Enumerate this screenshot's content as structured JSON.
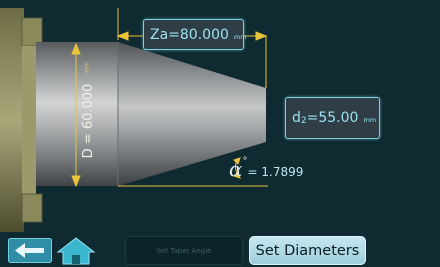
{
  "za": {
    "prefix": "Za",
    "value": "=80.000",
    "unit": "mm"
  },
  "d2": {
    "prefix": "d",
    "sub": "2",
    "value": "=55.00",
    "unit": "mm"
  },
  "diameter": {
    "label": "D = 60.000",
    "unit": "mm"
  },
  "alpha": {
    "symbol": "α",
    "degree": "°",
    "value": "= 1.7899"
  },
  "buttons": {
    "set_taper": "Set Taper Angle",
    "set_diameters": "Set Diameters"
  },
  "icons": {
    "back": "back-arrow-icon",
    "home": "home-icon"
  },
  "colors": {
    "dim_line": "#e9c33a",
    "accent": "#7fd0e0",
    "background": "#0f2a30"
  }
}
